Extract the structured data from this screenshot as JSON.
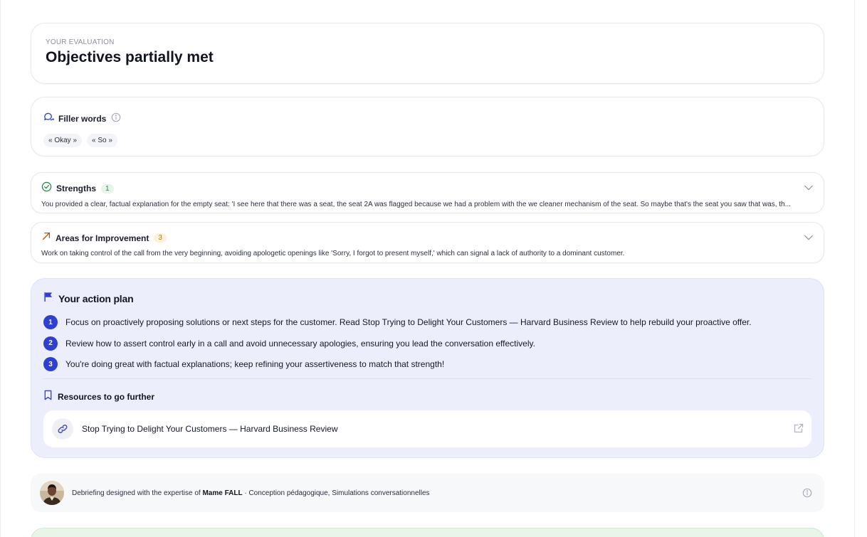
{
  "evaluation": {
    "kicker": "YOUR EVALUATION",
    "title": "Objectives partially met"
  },
  "filler": {
    "label": "Filler words",
    "chips": [
      "« Okay »",
      "« So »"
    ]
  },
  "strengths": {
    "label": "Strengths",
    "count": "1",
    "text": "You provided a clear, factual explanation for the empty seat: 'I see here that there was a seat, the seat 2A was flagged because we had a problem with the we cleaner mechanism of the seat. So maybe that's the seat you saw that was, th..."
  },
  "improvement": {
    "label": "Areas for Improvement",
    "count": "3",
    "text": "Work on taking control of the call from the very beginning, avoiding apologetic openings like 'Sorry, I forgot to present myself,' which can signal a lack of authority to a dominant customer."
  },
  "plan": {
    "title": "Your action plan",
    "steps": [
      {
        "num": "1",
        "text": "Focus on proactively proposing solutions or next steps for the customer. Read Stop Trying to Delight Your Customers — Harvard Business Review to help rebuild your proactive offer."
      },
      {
        "num": "2",
        "text": "Review how to assert control early in a call and avoid unnecessary apologies, ensuring you lead the conversation effectively."
      },
      {
        "num": "3",
        "text": "You're doing great with factual explanations; keep refining your assertiveness to match that strength!"
      }
    ],
    "resources_title": "Resources to go further",
    "resource": "Stop Trying to Delight Your Customers — Harvard Business Review"
  },
  "debrief": {
    "prefix": "Debriefing designed with the expertise of ",
    "name": "Mame FALL",
    "suffix": " · Conception pédagogique, Simulations conversationnelles"
  },
  "colors": {
    "accent": "#2f3fd1",
    "plan_bg": "#eceefb",
    "success": "#2c8a46",
    "warning": "#b07a14"
  }
}
